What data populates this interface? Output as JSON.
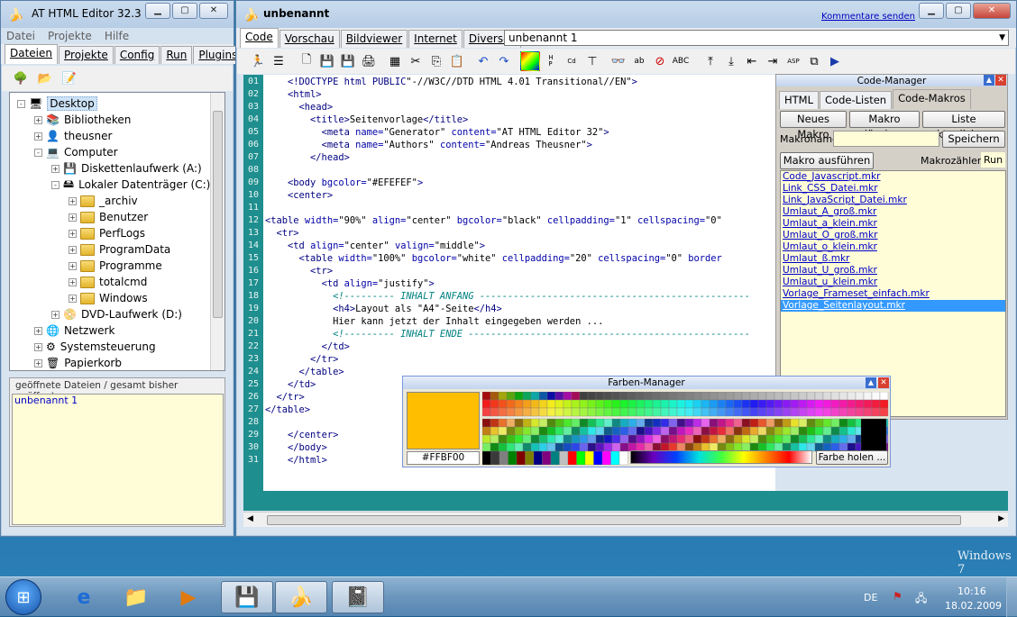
{
  "left_window": {
    "title": "AT HTML Editor 32.3",
    "menu": [
      "Datei",
      "Projekte",
      "Hilfe"
    ],
    "tabs": [
      {
        "label": "Dateien",
        "active": true
      },
      {
        "label": "Projekte",
        "active": false
      },
      {
        "label": "Config",
        "active": false
      },
      {
        "label": "Run",
        "active": false
      },
      {
        "label": "Plugins",
        "active": false
      }
    ],
    "tree": [
      {
        "label": "Desktop",
        "level": 0,
        "icon": "desktop-icon",
        "selected": true,
        "expander": "-"
      },
      {
        "label": "Bibliotheken",
        "level": 1,
        "icon": "library-icon",
        "expander": "+"
      },
      {
        "label": "theusner",
        "level": 1,
        "icon": "user-folder-icon",
        "expander": "+"
      },
      {
        "label": "Computer",
        "level": 1,
        "icon": "computer-icon",
        "expander": "-"
      },
      {
        "label": "Diskettenlaufwerk (A:)",
        "level": 2,
        "icon": "floppy-drive-icon",
        "expander": "+"
      },
      {
        "label": "Lokaler Datenträger (C:)",
        "level": 2,
        "icon": "hard-drive-icon",
        "expander": "-"
      },
      {
        "label": "_archiv",
        "level": 3,
        "icon": "folder-icon",
        "expander": "+"
      },
      {
        "label": "Benutzer",
        "level": 3,
        "icon": "folder-icon",
        "expander": "+"
      },
      {
        "label": "PerfLogs",
        "level": 3,
        "icon": "folder-icon",
        "expander": "+"
      },
      {
        "label": "ProgramData",
        "level": 3,
        "icon": "folder-icon",
        "expander": "+"
      },
      {
        "label": "Programme",
        "level": 3,
        "icon": "folder-icon",
        "expander": "+"
      },
      {
        "label": "totalcmd",
        "level": 3,
        "icon": "folder-icon",
        "expander": "+"
      },
      {
        "label": "Windows",
        "level": 3,
        "icon": "folder-icon",
        "expander": "+"
      },
      {
        "label": "DVD-Laufwerk (D:)",
        "level": 2,
        "icon": "dvd-drive-icon",
        "expander": "+"
      },
      {
        "label": "Netzwerk",
        "level": 1,
        "icon": "network-icon",
        "expander": "+"
      },
      {
        "label": "Systemsteuerung",
        "level": 1,
        "icon": "control-panel-icon",
        "expander": "+"
      },
      {
        "label": "Papierkorb",
        "level": 1,
        "icon": "recycle-bin-icon",
        "expander": "+"
      }
    ],
    "open_files_header": "geöffnete Dateien / gesamt bisher geöffnet",
    "open_files": [
      "unbenannt 1"
    ]
  },
  "editor_window": {
    "title": "unbenannt",
    "comment_link": "Kommentare senden",
    "view_tabs": [
      {
        "label": "Code",
        "active": true
      },
      {
        "label": "Vorschau",
        "active": false
      },
      {
        "label": "Bildviewer",
        "active": false
      },
      {
        "label": "Internet",
        "active": false
      },
      {
        "label": "Diverses",
        "active": false
      }
    ],
    "document_select": "unbenannt 1",
    "code_lines": [
      {
        "n": "01",
        "html": "    <span class='tag'>&lt;!DOCTYPE html PUBLIC</span>\"-//W3C//DTD HTML 4.01 Transitional//EN\"<span class='tag'>&gt;</span>"
      },
      {
        "n": "02",
        "html": "    <span class='tag'>&lt;html&gt;</span>"
      },
      {
        "n": "03",
        "html": "      <span class='tag'>&lt;head&gt;</span>"
      },
      {
        "n": "04",
        "html": "        <span class='tag'>&lt;title&gt;</span>Seitenvorlage<span class='tag'>&lt;/title&gt;</span>"
      },
      {
        "n": "05",
        "html": "          <span class='tag'>&lt;meta</span> <span class='at'>name=</span>\"Generator\" <span class='at'>content=</span>\"AT HTML Editor 32\"<span class='tag'>&gt;</span>"
      },
      {
        "n": "06",
        "html": "          <span class='tag'>&lt;meta</span> <span class='at'>name=</span>\"Authors\" <span class='at'>content=</span>\"Andreas Theusner\"<span class='tag'>&gt;</span>"
      },
      {
        "n": "07",
        "html": "        <span class='tag'>&lt;/head&gt;</span>"
      },
      {
        "n": "08",
        "html": ""
      },
      {
        "n": "09",
        "html": "    <span class='tag'>&lt;body</span> <span class='at'>bgcolor=</span>\"#EFEFEF\"<span class='tag'>&gt;</span>"
      },
      {
        "n": "10",
        "html": "    <span class='tag'>&lt;center&gt;</span>"
      },
      {
        "n": "11",
        "html": ""
      },
      {
        "n": "12",
        "html": "<span class='tag'>&lt;table</span> <span class='at'>width=</span>\"90%\" <span class='at'>align=</span>\"center\" <span class='at'>bgcolor=</span>\"black\" <span class='at'>cellpadding=</span>\"1\" <span class='at'>cellspacing=</span>\"0\""
      },
      {
        "n": "13",
        "html": "  <span class='tag'>&lt;tr&gt;</span>"
      },
      {
        "n": "14",
        "html": "    <span class='tag'>&lt;td</span> <span class='at'>align=</span>\"center\" <span class='at'>valign=</span>\"middle\"<span class='tag'>&gt;</span>"
      },
      {
        "n": "15",
        "html": "      <span class='tag'>&lt;table</span> <span class='at'>width=</span>\"100%\" <span class='at'>bgcolor=</span>\"white\" <span class='at'>cellpadding=</span>\"20\" <span class='at'>cellspacing=</span>\"0\" <span class='at'>border</span>"
      },
      {
        "n": "16",
        "html": "        <span class='tag'>&lt;tr&gt;</span>"
      },
      {
        "n": "17",
        "html": "          <span class='tag'>&lt;td</span> <span class='at'>align=</span>\"justify\"<span class='tag'>&gt;</span>"
      },
      {
        "n": "18",
        "html": "            <span class='cm'>&lt;!--------- INHALT ANFANG ------------------------------------------------</span>"
      },
      {
        "n": "19",
        "html": "            <span class='tag'>&lt;h4&gt;</span>Layout als \"A4\"-Seite<span class='tag'>&lt;/h4&gt;</span>"
      },
      {
        "n": "20",
        "html": "            Hier kann jetzt der Inhalt eingegeben werden ..."
      },
      {
        "n": "21",
        "html": "            <span class='cm'>&lt;!--------- INHALT ENDE --------------------------------------------------</span>"
      },
      {
        "n": "22",
        "html": "          <span class='tag'>&lt;/td&gt;</span>"
      },
      {
        "n": "23",
        "html": "        <span class='tag'>&lt;/tr&gt;</span>"
      },
      {
        "n": "24",
        "html": "      <span class='tag'>&lt;/table&gt;</span>"
      },
      {
        "n": "25",
        "html": "    <span class='tag'>&lt;/td&gt;</span>"
      },
      {
        "n": "26",
        "html": "  <span class='tag'>&lt;/tr&gt;</span>"
      },
      {
        "n": "27",
        "html": "<span class='tag'>&lt;/table&gt;</span>"
      },
      {
        "n": "28",
        "html": ""
      },
      {
        "n": "29",
        "html": "    <span class='tag'>&lt;/center&gt;</span>"
      },
      {
        "n": "30",
        "html": "    <span class='tag'>&lt;/body&gt;</span>"
      },
      {
        "n": "31",
        "html": "    <span class='tag'>&lt;/html&gt;</span>"
      }
    ]
  },
  "code_manager": {
    "title": "Code-Manager",
    "tabs": [
      {
        "label": "HTML",
        "active": false
      },
      {
        "label": "Code-Listen",
        "active": false
      },
      {
        "label": "Code-Makros",
        "active": true
      }
    ],
    "new_macro": "Neues Makro",
    "delete_macro": "Makro löschen",
    "refresh_list": "Liste aktualisieren",
    "macro_name_label": "Makroname",
    "macro_name_value": "",
    "save": "Speichern",
    "run_macro": "Makro ausführen",
    "counter_label": "Makrozähler",
    "counter_value": "Run",
    "macros": [
      {
        "name": "Code_Javascript.mkr",
        "selected": false
      },
      {
        "name": "Link_CSS_Datei.mkr",
        "selected": false
      },
      {
        "name": "Link_JavaScript_Datei.mkr",
        "selected": false
      },
      {
        "name": "Umlaut_A_groß.mkr",
        "selected": false
      },
      {
        "name": "Umlaut_a_klein.mkr",
        "selected": false
      },
      {
        "name": "Umlaut_O_groß.mkr",
        "selected": false
      },
      {
        "name": "Umlaut_o_klein.mkr",
        "selected": false
      },
      {
        "name": "Umlaut_ß.mkr",
        "selected": false
      },
      {
        "name": "Umlaut_U_groß.mkr",
        "selected": false
      },
      {
        "name": "Umlaut_u_klein.mkr",
        "selected": false
      },
      {
        "name": "Vorlage_Frameset_einfach.mkr",
        "selected": false
      },
      {
        "name": "Vorlage_Seitenlayout.mkr",
        "selected": true
      }
    ]
  },
  "color_manager": {
    "title": "Farben-Manager",
    "current_color": "#FFBF00",
    "hex_value": "#FFBF00",
    "pick_button": "Farbe holen ..."
  },
  "desktop": {
    "watermark": "Windows 7"
  },
  "taskbar": {
    "language": "DE",
    "time": "10:16",
    "date": "18.02.2009",
    "apps": [
      "ie-icon",
      "explorer-icon",
      "media-player-icon",
      "save-disk-icon",
      "at-html-editor-icon",
      "notepad-icon"
    ]
  }
}
